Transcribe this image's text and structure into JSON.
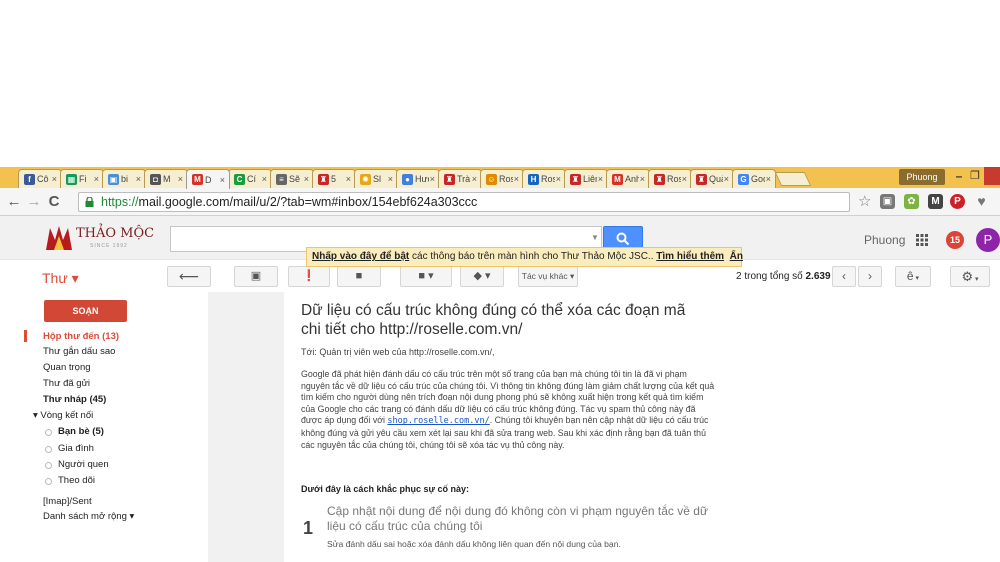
{
  "browser": {
    "tabs": [
      {
        "title": "Cô",
        "favicon": "facebook-icon",
        "color": "#3b5998",
        "glyph": "f"
      },
      {
        "title": "Fi",
        "favicon": "sheet-icon",
        "color": "#0f9d58",
        "glyph": "▦"
      },
      {
        "title": "bi",
        "favicon": "doc-icon",
        "color": "#4a90d9",
        "glyph": "▣"
      },
      {
        "title": "M",
        "favicon": "drive-icon",
        "color": "#555555",
        "glyph": "◘"
      },
      {
        "title": "D",
        "favicon": "gmail-icon",
        "color": "#d93025",
        "glyph": "M",
        "active": true
      },
      {
        "title": "Cí",
        "favicon": "site-icon",
        "color": "#1a9b3c",
        "glyph": "C"
      },
      {
        "title": "Sẽ",
        "favicon": "chart-icon",
        "color": "#666666",
        "glyph": "≡"
      },
      {
        "title": "5",
        "favicon": "thaomoc-icon",
        "color": "#c62828",
        "glyph": "♜"
      },
      {
        "title": "Sl",
        "favicon": "sun-icon",
        "color": "#e6a817",
        "glyph": "✺"
      },
      {
        "title": "Hướn",
        "favicon": "chrome-icon",
        "color": "#3f7fe0",
        "glyph": "●"
      },
      {
        "title": "Trà c",
        "favicon": "thaomoc-icon",
        "color": "#c62828",
        "glyph": "♜"
      },
      {
        "title": "Rosel",
        "favicon": "person-icon",
        "color": "#e08a00",
        "glyph": "☺"
      },
      {
        "title": "Rosel",
        "favicon": "h-icon",
        "color": "#1565c0",
        "glyph": "H"
      },
      {
        "title": "Liên l",
        "favicon": "thaomoc-icon",
        "color": "#c62828",
        "glyph": "♜"
      },
      {
        "title": "Anh I",
        "favicon": "gmail-icon",
        "color": "#d93025",
        "glyph": "M"
      },
      {
        "title": "Rosel",
        "favicon": "thaomoc-icon",
        "color": "#c62828",
        "glyph": "♜"
      },
      {
        "title": "Quà 1",
        "favicon": "thaomoc-icon",
        "color": "#c62828",
        "glyph": "♜"
      },
      {
        "title": "Goog",
        "favicon": "google-icon",
        "color": "#4285f4",
        "glyph": "G"
      }
    ],
    "profile": "Phuong",
    "url_https": "https://",
    "url_rest": "mail.google.com/mail/u/2/?tab=wm#inbox/154ebf624a303ccc"
  },
  "gmail": {
    "logo_text": "THẢO MỘC",
    "logo_sub": "SINCE 1992",
    "user": "Phuong",
    "notification_count": "15",
    "avatar_letter": "P",
    "notice": {
      "link1": "Nhấp vào đây để bật",
      "text": " các thông báo trên màn hình cho Thư Thảo Mộc JSC.. ",
      "link2": "Tìm hiểu thêm",
      "link3": "Ẩn"
    },
    "mail_label": "Thư ▾",
    "more_label": "Tác vụ khác ▾",
    "pager_prefix": "2 trong tổng số ",
    "pager_total": "2.639",
    "lang_button": "ê",
    "compose": "SOẠN",
    "nav": {
      "inbox": "Hộp thư đến (13)",
      "starred": "Thư gắn dấu sao",
      "important": "Quan trọng",
      "sent": "Thư đã gửi",
      "drafts": "Thư nháp (45)",
      "circles": "▾ Vòng kết nối",
      "friends": "Bạn bè (5)",
      "family": "Gia đình",
      "acquaintances": "Người quen",
      "following": "Theo dõi",
      "imap_sent": "[Imap]/Sent",
      "more": "Danh sách mở rộng ▾"
    }
  },
  "message": {
    "subject": "Dữ liệu có cấu trúc không đúng có thể xóa các đoạn mã chi tiết cho http://roselle.com.vn/",
    "to": "Tới: Quản trị viên web của http://roselle.com.vn/,",
    "body_pre": "Google đã phát hiện đánh dấu có cấu trúc trên một số trang của bạn mà chúng tôi tin là đã vi phạm nguyên tắc về dữ liệu có cấu trúc của chúng tôi. Vì thông tin không đúng làm giảm chất lượng của kết quả tìm kiếm cho người dùng nên trích đoạn nội dung phong phú sẽ không xuất hiện trong kết quả tìm kiếm của Google cho các trang có đánh dấu dữ liệu có cấu trúc không đúng. Tác vụ spam thủ công này đã được áp dụng đối với ",
    "body_link": "shop.roselle.com.vn/",
    "body_post": ". Chúng tôi khuyên bạn nên cập nhật dữ liệu có cấu trúc không đúng và gửi yêu cầu xem xét lại sau khi đã sửa trang web. Sau khi xác định rằng bạn đã tuân thủ các nguyên tắc của chúng tôi, chúng tôi sẽ xóa tác vụ thủ công này.",
    "fix_heading": "Dưới đây là cách khắc phục sự cố này:",
    "step_number": "1",
    "step_title": "Cập nhật nội dung để nội dung đó không còn vi phạm nguyên tắc về dữ liệu có cấu trúc của chúng tôi",
    "step_desc": "Sửa đánh dấu sai hoặc xóa đánh dấu không liên quan đến nội dung của bạn."
  }
}
